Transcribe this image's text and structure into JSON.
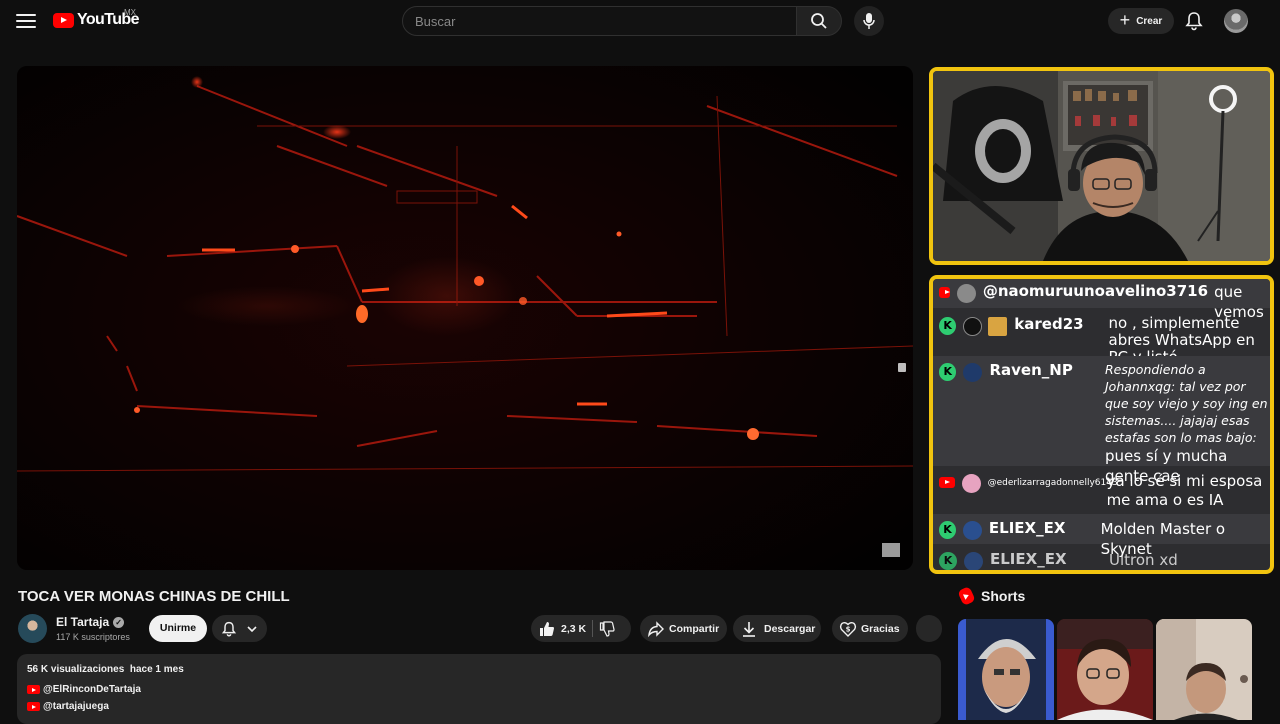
{
  "header": {
    "logo_text": "YouTube",
    "country": "MX",
    "search_placeholder": "Buscar",
    "create_label": "Crear"
  },
  "video": {
    "title": "TOCA VER MONAS CHINAS DE CHILL",
    "channel_name": "El Tartaja",
    "subscribers": "117 K suscriptores",
    "join_label": "Unirme",
    "likes": "2,3 K",
    "share_label": "Compartir",
    "download_label": "Descargar",
    "thanks_label": "Gracias",
    "views": "56 K visualizaciones",
    "time_ago": "hace 1 mes",
    "description_links": [
      "@ElRinconDeTartaja",
      "@tartajajuega"
    ]
  },
  "chat": {
    "messages": [
      {
        "badge": "youtube",
        "user": "@naomuruunoavelino3716",
        "text": "que vemos"
      },
      {
        "badge": "kick",
        "user": "kared23",
        "text": "no , simplemente abres WhatsApp en PC y listó"
      },
      {
        "badge": "kick",
        "user": "Raven_NP",
        "reply": "Respondiendo a Johannxqg: tal vez por que soy viejo y soy ing en sistemas.... jajajaj esas estafas son lo mas bajo:",
        "text": "pues sí y mucha gente cae"
      },
      {
        "badge": "youtube",
        "user": "@ederlizarragadonnelly6143",
        "text": "ya lo sé si mi esposa me ama o es IA"
      },
      {
        "badge": "kick",
        "user": "ELIEX_EX",
        "text": "Molden Master o Skynet"
      },
      {
        "badge": "kick",
        "user": "ELIEX_EX",
        "text": "Ultron xd"
      }
    ]
  },
  "shorts": {
    "title": "Shorts"
  },
  "colors": {
    "background": "#0f0f0f",
    "youtube_red": "#ff0000",
    "overlay_border": "#f1c40f",
    "kick_green": "#2ecc71"
  }
}
